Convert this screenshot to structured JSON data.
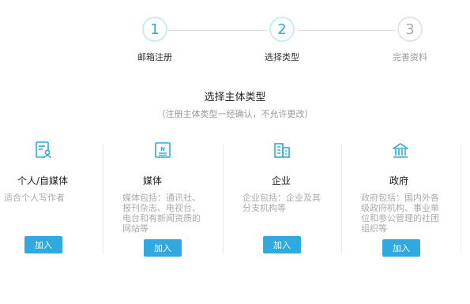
{
  "steps": [
    {
      "number": "1",
      "label": "邮箱注册"
    },
    {
      "number": "2",
      "label": "选择类型"
    },
    {
      "number": "3",
      "label": "完善资料"
    }
  ],
  "section": {
    "title": "选择主体类型",
    "subtitle": "（注册主体类型一经确认，不允许更改）"
  },
  "types": [
    {
      "icon": "personal-profile-icon",
      "name": "个人/自媒体",
      "description": "适合个人写作者",
      "button": "加入"
    },
    {
      "icon": "newspaper-icon",
      "name": "媒体",
      "description": "媒体包括：通讯社、报刊杂志、电视台、电台和有新闻资质的网站等",
      "button": "加入"
    },
    {
      "icon": "building-icon",
      "name": "企业",
      "description": "企业包括：企业及其分支机构等",
      "button": "加入"
    },
    {
      "icon": "government-icon",
      "name": "政府",
      "description": "政府包括：国内外各级政府机构、事业单位和参公管理的社团组织等",
      "button": "加入"
    }
  ],
  "colors": {
    "accent": "#2fa9e0",
    "muted_text": "#aaaaaa"
  }
}
